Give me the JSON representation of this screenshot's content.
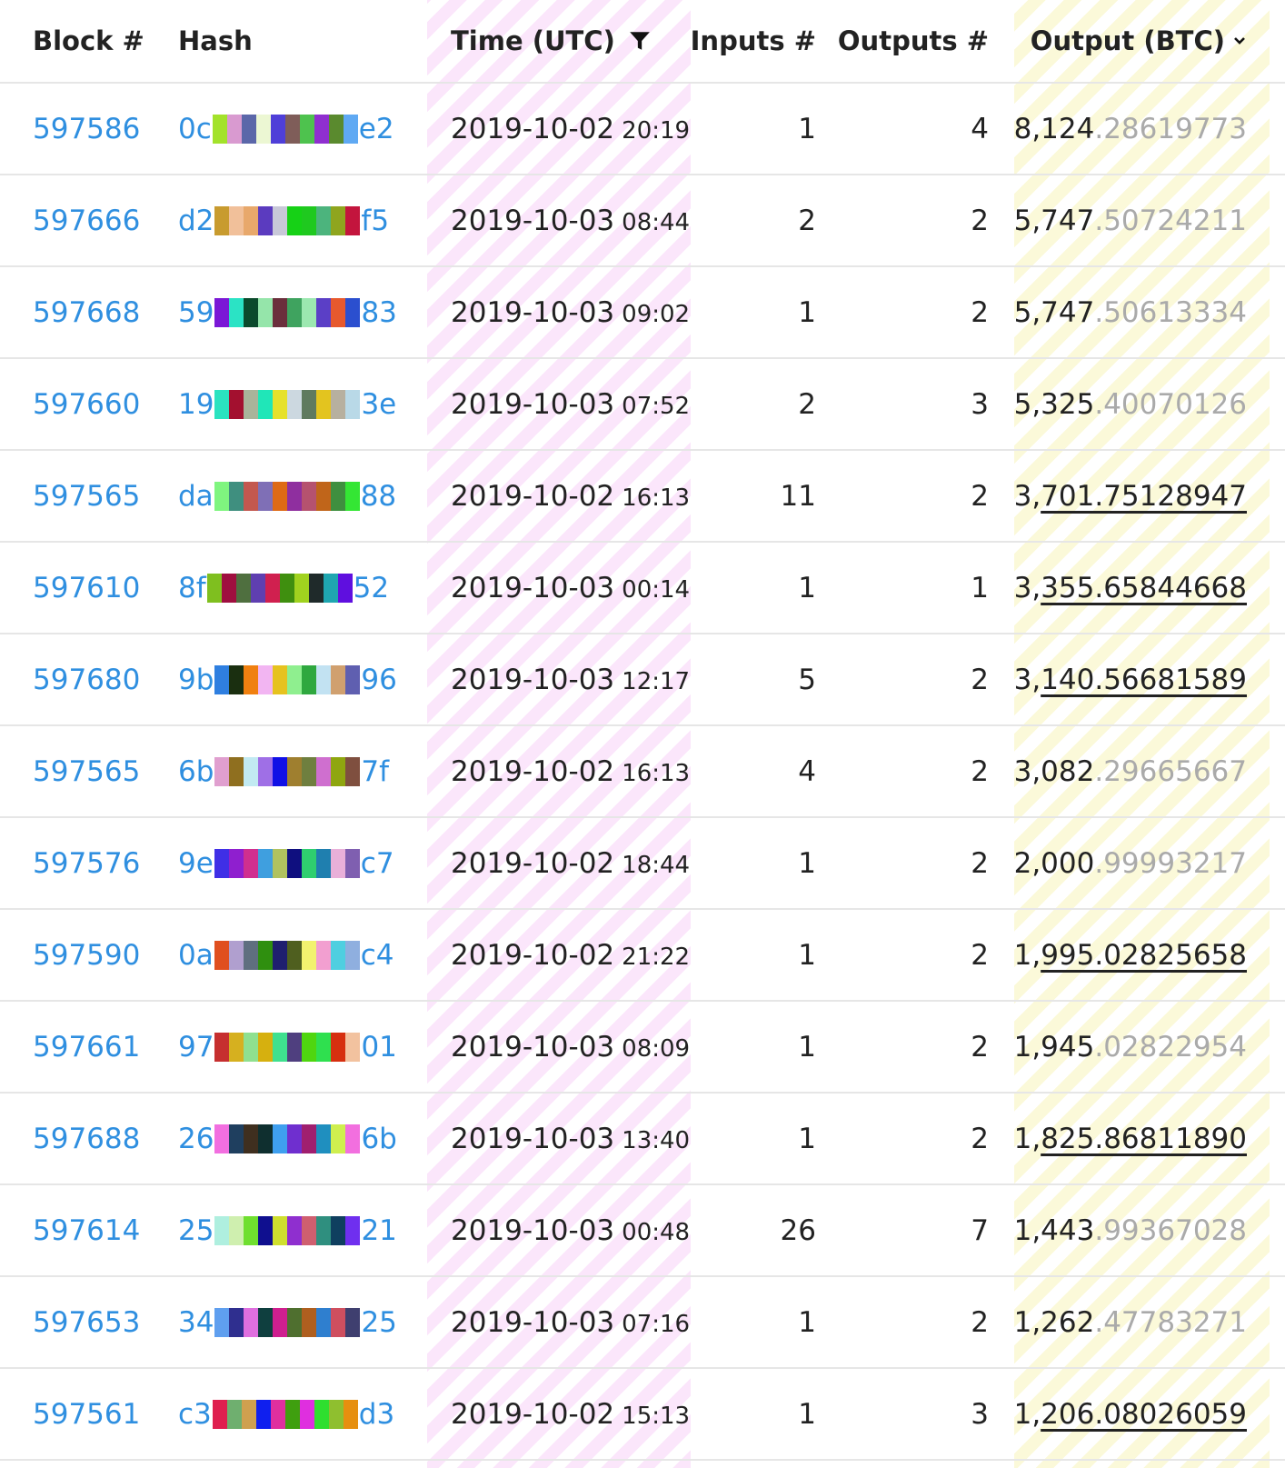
{
  "header": {
    "block": "Block #",
    "hash": "Hash",
    "time": "Time (UTC)",
    "inputs": "Inputs #",
    "outputs": "Outputs #",
    "output_btc": "Output (BTC)",
    "filter_icon": "filter-icon",
    "sort_icon": "chevron-down-icon"
  },
  "colors": {
    "link": "#2f8fe0",
    "time_stripe": "#fbe6fb",
    "btc_stripe": "#fbf9d9",
    "muted": "#aaaaaa"
  },
  "rows": [
    {
      "block": "597586",
      "hash_start": "0c",
      "hash_end": "e2",
      "date": "2019-10-02",
      "hm": "20:19",
      "inputs": "1",
      "outputs": "4",
      "btc_int": "8,124",
      "btc_frac": ".28619773",
      "frac_muted": true,
      "underline": false,
      "swatches": [
        "#a3e22b",
        "#d99ad0",
        "#5b67a9",
        "#ecf7d3",
        "#4f3fd8",
        "#7f5d59",
        "#4ec24e",
        "#8f2fcf",
        "#5a8a2e",
        "#5fa9f3"
      ]
    },
    {
      "block": "597666",
      "hash_start": "d2",
      "hash_end": "f5",
      "date": "2019-10-03",
      "hm": "08:44",
      "inputs": "2",
      "outputs": "2",
      "btc_int": "5,747",
      "btc_frac": ".50724211",
      "frac_muted": true,
      "underline": false,
      "swatches": [
        "#c89b2f",
        "#f1c09a",
        "#e8a86b",
        "#5b3bbf",
        "#c8c8d8",
        "#16d116",
        "#1fc91f",
        "#4cb47d",
        "#8fa51e",
        "#c3153d"
      ]
    },
    {
      "block": "597668",
      "hash_start": "59",
      "hash_end": "83",
      "date": "2019-10-03",
      "hm": "09:02",
      "inputs": "1",
      "outputs": "2",
      "btc_int": "5,747",
      "btc_frac": ".50613334",
      "frac_muted": true,
      "underline": false,
      "swatches": [
        "#7b18d6",
        "#2be3c5",
        "#0b4a2c",
        "#95e5aa",
        "#6b2f3c",
        "#3fa35f",
        "#9ce8b0",
        "#5b3fc6",
        "#e7592d",
        "#2b4fcf"
      ]
    },
    {
      "block": "597660",
      "hash_start": "19",
      "hash_end": "3e",
      "date": "2019-10-03",
      "hm": "07:52",
      "inputs": "2",
      "outputs": "3",
      "btc_int": "5,325",
      "btc_frac": ".40070126",
      "frac_muted": true,
      "underline": false,
      "swatches": [
        "#2be3c0",
        "#a3102f",
        "#a9b49a",
        "#20e6b8",
        "#e6e12b",
        "#ccd8e0",
        "#5f7a5f",
        "#e3c41f",
        "#b7b09f",
        "#b9d9e7"
      ]
    },
    {
      "block": "597565",
      "hash_start": "da",
      "hash_end": "88",
      "date": "2019-10-02",
      "hm": "16:13",
      "inputs": "11",
      "outputs": "2",
      "btc_int": "3,",
      "btc_frac": "701.75128947",
      "frac_muted": false,
      "underline": true,
      "swatches": [
        "#7ff57f",
        "#3f8f7f",
        "#c3584f",
        "#7f6fb6",
        "#de6a15",
        "#8f2f9f",
        "#b5526f",
        "#c0651a",
        "#3f8f3f",
        "#34e634"
      ]
    },
    {
      "block": "597610",
      "hash_start": "8f",
      "hash_end": "52",
      "date": "2019-10-03",
      "hm": "00:14",
      "inputs": "1",
      "outputs": "1",
      "btc_int": "3,",
      "btc_frac": "355.65844668",
      "frac_muted": false,
      "underline": true,
      "swatches": [
        "#7fbf1f",
        "#9f0f3f",
        "#4f6f3f",
        "#5f3fb0",
        "#d0204f",
        "#3f8f0f",
        "#a0d21f",
        "#1f2a2a",
        "#1fa6b0",
        "#5f0fdf"
      ]
    },
    {
      "block": "597680",
      "hash_start": "9b",
      "hash_end": "96",
      "date": "2019-10-03",
      "hm": "12:17",
      "inputs": "5",
      "outputs": "2",
      "btc_int": "3,",
      "btc_frac": "140.56681589",
      "frac_muted": false,
      "underline": true,
      "swatches": [
        "#2f7fe0",
        "#1a2f10",
        "#f08010",
        "#f2b5f2",
        "#e6c21f",
        "#8fef8f",
        "#2fa83f",
        "#c2e2f2",
        "#d0a06f",
        "#5f5fb0"
      ]
    },
    {
      "block": "597565",
      "hash_start": "6b",
      "hash_end": "7f",
      "date": "2019-10-02",
      "hm": "16:13",
      "inputs": "4",
      "outputs": "2",
      "btc_int": "3,082",
      "btc_frac": ".29665667",
      "frac_muted": true,
      "underline": false,
      "swatches": [
        "#e09fcf",
        "#8f6f1f",
        "#c2eaf2",
        "#9f6fe6",
        "#1010e6",
        "#9f7f2f",
        "#6f7f3f",
        "#cf6fcf",
        "#8fa60f",
        "#7f4f3f"
      ]
    },
    {
      "block": "597576",
      "hash_start": "9e",
      "hash_end": "c7",
      "date": "2019-10-02",
      "hm": "18:44",
      "inputs": "1",
      "outputs": "2",
      "btc_int": "2,000",
      "btc_frac": ".99993217",
      "frac_muted": true,
      "underline": false,
      "swatches": [
        "#3f2fe6",
        "#8f1fcf",
        "#d02f8f",
        "#3f9fdf",
        "#b0c25f",
        "#0f0f7f",
        "#2fcf6f",
        "#1f7faf",
        "#e9b0d9",
        "#7f5fb0"
      ]
    },
    {
      "block": "597590",
      "hash_start": "0a",
      "hash_end": "c4",
      "date": "2019-10-02",
      "hm": "21:22",
      "inputs": "1",
      "outputs": "2",
      "btc_int": "1,",
      "btc_frac": "995.02825658",
      "frac_muted": false,
      "underline": true,
      "swatches": [
        "#e04f1f",
        "#b09fcf",
        "#5f6f7f",
        "#2f8f0f",
        "#1f1f6f",
        "#4f5f1f",
        "#f2f26f",
        "#f29fd0",
        "#4fcfe0",
        "#8fafdf"
      ]
    },
    {
      "block": "597661",
      "hash_start": "97",
      "hash_end": "01",
      "date": "2019-10-03",
      "hm": "08:09",
      "inputs": "1",
      "outputs": "2",
      "btc_int": "1,945",
      "btc_frac": ".02822954",
      "frac_muted": true,
      "underline": false,
      "swatches": [
        "#c62f2f",
        "#d6b01f",
        "#8fe08f",
        "#d6b00f",
        "#3fe08f",
        "#4f3f7f",
        "#4fd60f",
        "#2fe04f",
        "#d62f0f",
        "#f2c29f"
      ]
    },
    {
      "block": "597688",
      "hash_start": "26",
      "hash_end": "6b",
      "date": "2019-10-03",
      "hm": "13:40",
      "inputs": "1",
      "outputs": "2",
      "btc_int": "1,",
      "btc_frac": "825.86811890",
      "frac_muted": false,
      "underline": true,
      "swatches": [
        "#f26fe0",
        "#1f3f5f",
        "#3f2f1f",
        "#0f2f2f",
        "#3f9fef",
        "#6f2fcf",
        "#a01f6f",
        "#1f8fbf",
        "#cfef4f",
        "#f26fdf"
      ]
    },
    {
      "block": "597614",
      "hash_start": "25",
      "hash_end": "21",
      "date": "2019-10-03",
      "hm": "00:48",
      "inputs": "26",
      "outputs": "7",
      "btc_int": "1,443",
      "btc_frac": ".99367028",
      "frac_muted": true,
      "underline": false,
      "swatches": [
        "#afefdf",
        "#cfefaf",
        "#6fdf2f",
        "#0f0f8f",
        "#cfdf2f",
        "#8f2fcf",
        "#cf5f6f",
        "#2f8f7f",
        "#0f3f5f",
        "#6f2fef"
      ]
    },
    {
      "block": "597653",
      "hash_start": "34",
      "hash_end": "25",
      "date": "2019-10-03",
      "hm": "07:16",
      "inputs": "1",
      "outputs": "2",
      "btc_int": "1,262",
      "btc_frac": ".47783271",
      "frac_muted": true,
      "underline": false,
      "swatches": [
        "#5f9fef",
        "#2f2f8f",
        "#df6fdf",
        "#0f3f3f",
        "#cf1f8f",
        "#4f6f2f",
        "#af5f1f",
        "#2f7fcf",
        "#cf4f5f",
        "#3f3f6f"
      ]
    },
    {
      "block": "597561",
      "hash_start": "c3",
      "hash_end": "d3",
      "date": "2019-10-02",
      "hm": "15:13",
      "inputs": "1",
      "outputs": "3",
      "btc_int": "1,",
      "btc_frac": "206.08026059",
      "frac_muted": false,
      "underline": true,
      "swatches": [
        "#df1f4f",
        "#6faf6f",
        "#cfa04f",
        "#0f1fef",
        "#df2f9f",
        "#3f9f0f",
        "#df2fdf",
        "#2fdf2f",
        "#8fbf2f",
        "#e68f0f"
      ]
    }
  ]
}
